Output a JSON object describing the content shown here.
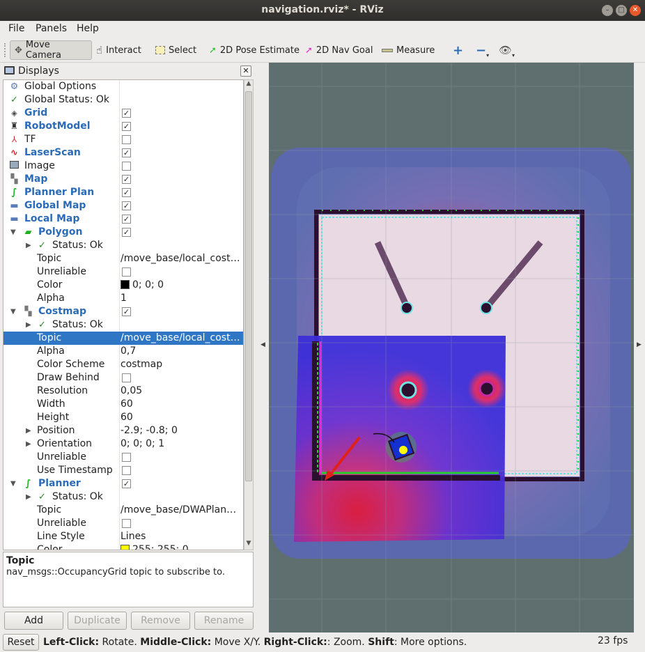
{
  "window": {
    "title": "navigation.rviz* - RViz"
  },
  "menu": {
    "file": "File",
    "panels": "Panels",
    "help": "Help"
  },
  "toolbar": {
    "move_camera": "Move Camera",
    "interact": "Interact",
    "select": "Select",
    "pose_estimate": "2D Pose Estimate",
    "nav_goal": "2D Nav Goal",
    "measure": "Measure"
  },
  "displays": {
    "title": "Displays",
    "rows": [
      {
        "label": "Global Options",
        "value": ""
      },
      {
        "label": "Global Status: Ok",
        "value": ""
      },
      {
        "label": "Grid",
        "value": ""
      },
      {
        "label": "RobotModel",
        "value": ""
      },
      {
        "label": "TF",
        "value": ""
      },
      {
        "label": "LaserScan",
        "value": ""
      },
      {
        "label": "Image",
        "value": ""
      },
      {
        "label": "Map",
        "value": ""
      },
      {
        "label": "Planner Plan",
        "value": ""
      },
      {
        "label": "Global Map",
        "value": ""
      },
      {
        "label": "Local Map",
        "value": ""
      },
      {
        "label": "Polygon",
        "value": ""
      },
      {
        "label": "Status: Ok",
        "value": ""
      },
      {
        "label": "Topic",
        "value": "/move_base/local_cost…"
      },
      {
        "label": "Unreliable",
        "value": ""
      },
      {
        "label": "Color",
        "value": "0; 0; 0"
      },
      {
        "label": "Alpha",
        "value": "1"
      },
      {
        "label": "Costmap",
        "value": ""
      },
      {
        "label": "Status: Ok",
        "value": ""
      },
      {
        "label": "Topic",
        "value": "/move_base/local_cost…"
      },
      {
        "label": "Alpha",
        "value": "0,7"
      },
      {
        "label": "Color Scheme",
        "value": "costmap"
      },
      {
        "label": "Draw Behind",
        "value": ""
      },
      {
        "label": "Resolution",
        "value": "0,05"
      },
      {
        "label": "Width",
        "value": "60"
      },
      {
        "label": "Height",
        "value": "60"
      },
      {
        "label": "Position",
        "value": "-2.9; -0.8; 0"
      },
      {
        "label": "Orientation",
        "value": "0; 0; 0; 1"
      },
      {
        "label": "Unreliable",
        "value": ""
      },
      {
        "label": "Use Timestamp",
        "value": ""
      },
      {
        "label": "Planner",
        "value": ""
      },
      {
        "label": "Status: Ok",
        "value": ""
      },
      {
        "label": "Topic",
        "value": "/move_base/DWAPlan…"
      },
      {
        "label": "Unreliable",
        "value": ""
      },
      {
        "label": "Line Style",
        "value": "Lines"
      },
      {
        "label": "Color",
        "value": "255; 255; 0"
      }
    ]
  },
  "description": {
    "heading": "Topic",
    "text": "nav_msgs::OccupancyGrid topic to subscribe to."
  },
  "buttons": {
    "add": "Add",
    "duplicate": "Duplicate",
    "remove": "Remove",
    "rename": "Rename"
  },
  "statusbar": {
    "reset": "Reset",
    "left_click": "Left-Click:",
    "left_action": " Rotate. ",
    "middle_click": "Middle-Click:",
    "middle_action": " Move X/Y. ",
    "right_click": "Right-Click:",
    "right_action": ": Zoom. ",
    "shift": "Shift",
    "shift_action": ": More options.",
    "fps": "23 fps"
  },
  "colors": {
    "selection": "#2f77c5",
    "display_name": "#2b6bb7",
    "costmap_blue": "#3b2ed8",
    "costmap_red": "#e0204a",
    "map_free": "#e9d9e3",
    "plan_green": "#25d22c"
  }
}
